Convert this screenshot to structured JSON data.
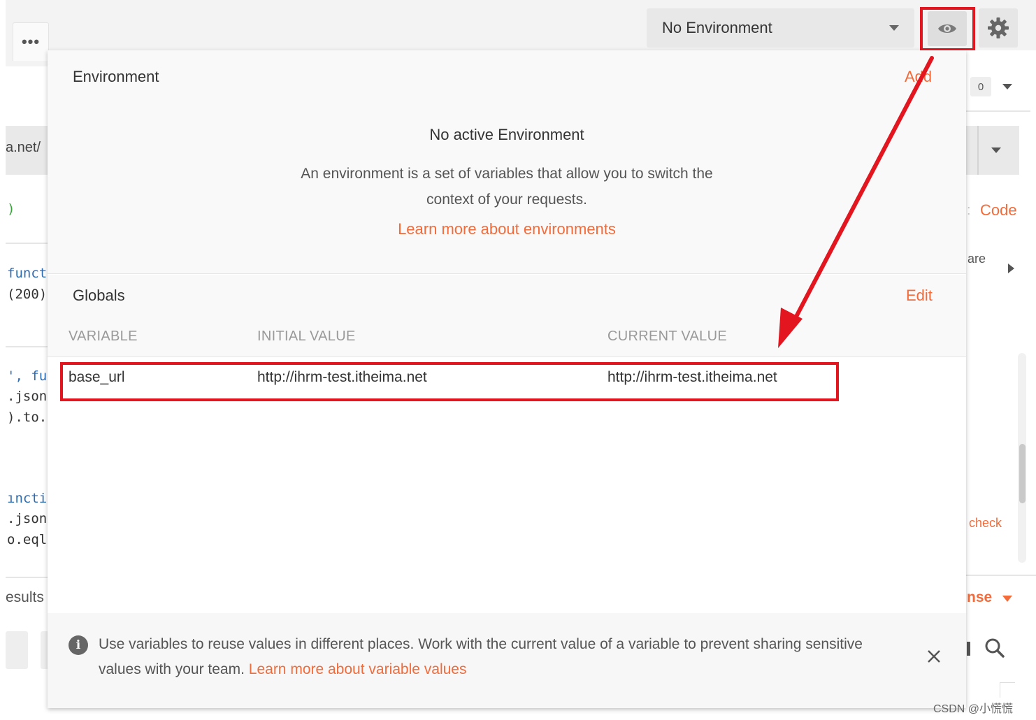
{
  "background": {
    "dots_label": "•••",
    "url_fragment": "a.net/",
    "code_lines": [
      ")",
      "funct",
      "(200)",
      "', fur",
      ".json",
      ").to.",
      "ıncti",
      ".json",
      "o.eql"
    ],
    "results_fragment": "esults",
    "right": {
      "env_select_value": "No Environment",
      "badge_count": "0",
      "code_link": "Code",
      "are_fragment": "are",
      "check_fragment": "check",
      "nse_fragment": "nse"
    }
  },
  "icons": {
    "eye": "eye-icon",
    "gear": "gear-icon",
    "info": "info-icon",
    "close": "close-icon",
    "search": "search-icon"
  },
  "popover": {
    "environment": {
      "title": "Environment",
      "add_label": "Add",
      "empty_title": "No active Environment",
      "empty_desc_line1": "An environment is a set of variables that allow you to switch the",
      "empty_desc_line2": "context of your requests.",
      "learn_more": "Learn more about environments"
    },
    "globals": {
      "title": "Globals",
      "edit_label": "Edit",
      "columns": [
        "VARIABLE",
        "INITIAL VALUE",
        "CURRENT VALUE"
      ],
      "rows": [
        {
          "variable": "base_url",
          "initial_value": "http://ihrm-test.itheima.net",
          "current_value": "http://ihrm-test.itheima.net"
        }
      ]
    },
    "info_bar": {
      "text": "Use variables to reuse values in different places. Work with the current value of a variable to prevent sharing sensitive values with your team.",
      "link": "Learn more about variable values"
    }
  },
  "watermark": "CSDN @小慌慌",
  "colors": {
    "accent_orange": "#f26b3a",
    "highlight_red": "#e3151f"
  }
}
